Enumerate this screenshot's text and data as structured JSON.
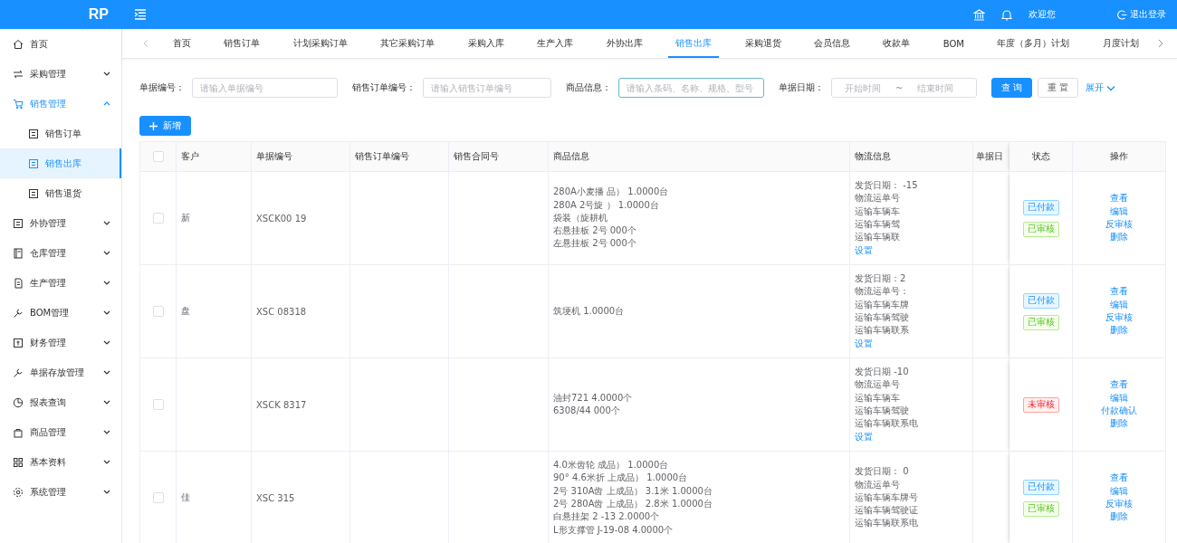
{
  "header": {
    "logo": "RP",
    "welcome": "欢迎您",
    "logout": "退出登录"
  },
  "sidebar": {
    "items": [
      {
        "label": "首页",
        "selected": false
      },
      {
        "label": "采购管理",
        "expanded": false,
        "selected": false
      },
      {
        "label": "销售管理",
        "expanded": true,
        "selected": true,
        "children": [
          {
            "label": "销售订单",
            "selected": false
          },
          {
            "label": "销售出库",
            "selected": true
          },
          {
            "label": "销售退货",
            "selected": false
          }
        ]
      },
      {
        "label": "外协管理",
        "expanded": false,
        "selected": false
      },
      {
        "label": "仓库管理",
        "expanded": false,
        "selected": false
      },
      {
        "label": "生产管理",
        "expanded": false,
        "selected": false
      },
      {
        "label": "BOM管理",
        "expanded": false,
        "selected": false
      },
      {
        "label": "财务管理",
        "expanded": false,
        "selected": false
      },
      {
        "label": "单据存放管理",
        "expanded": false,
        "selected": false
      },
      {
        "label": "报表查询",
        "expanded": false,
        "selected": false
      },
      {
        "label": "商品管理",
        "expanded": false,
        "selected": false
      },
      {
        "label": "基本资料",
        "expanded": false,
        "selected": false
      },
      {
        "label": "系统管理",
        "expanded": false,
        "selected": false
      }
    ]
  },
  "tabs": [
    {
      "label": "首页",
      "selected": false
    },
    {
      "label": "销售订单",
      "selected": false
    },
    {
      "label": "计划采购订单",
      "selected": false
    },
    {
      "label": "其它采购订单",
      "selected": false
    },
    {
      "label": "采购入库",
      "selected": false
    },
    {
      "label": "生产入库",
      "selected": false
    },
    {
      "label": "外协出库",
      "selected": false
    },
    {
      "label": "销售出库",
      "selected": true
    },
    {
      "label": "采购退货",
      "selected": false
    },
    {
      "label": "会员信息",
      "selected": false
    },
    {
      "label": "收款单",
      "selected": false
    },
    {
      "label": "BOM",
      "selected": false
    },
    {
      "label": "年度（多月）计划",
      "selected": false
    },
    {
      "label": "月度计划",
      "selected": false
    }
  ],
  "filters": {
    "fields": [
      {
        "label": "单据编号：",
        "placeholder": "请输入单据编号",
        "focused": false
      },
      {
        "label": "销售订单编号：",
        "placeholder": "请输入销售订单编号",
        "focused": false
      },
      {
        "label": "商品信息：",
        "placeholder": "请输入条码、名称、规格、型号",
        "focused": true
      }
    ],
    "date": {
      "label": "单据日期：",
      "start_placeholder": "开始时间",
      "separator": "~",
      "end_placeholder": "结束时间"
    },
    "buttons": [
      {
        "label": "查 询",
        "kind": "primary"
      },
      {
        "label": "重 置",
        "kind": "default"
      }
    ],
    "expand": "展开"
  },
  "add_button": "新增",
  "table": {
    "header_checked": false,
    "columns": [
      "客户",
      "单据编号",
      "销售订单编号",
      "销售合同号",
      "商品信息",
      "物流信息",
      "单据日",
      "状态",
      "操作"
    ],
    "rows": [
      {
        "checked": false,
        "customer": "新",
        "number": "XSCK00  19",
        "goods": [
          "280A小麦播   品）  1.0000台",
          "280A 2号旋   ）  1.0000台",
          "袋装（旋耕机",
          "右悬挂板 2号   000个",
          "左悬挂板 2号   000个"
        ],
        "logistics": [
          "发货日期：   -15",
          "物流运单号",
          "运输车辆车",
          "运输车辆驾",
          "运输车辆联"
        ],
        "logistics_link": "设置",
        "tags": [
          {
            "label": "已付款",
            "kind": "paid"
          },
          {
            "label": "已审核",
            "kind": "approved"
          }
        ],
        "actions": [
          "查看",
          "编辑",
          "反审核",
          "删除"
        ]
      },
      {
        "checked": false,
        "customer": "盘",
        "number": "XSC   08318",
        "goods": [
          "筑埂机     1.0000台"
        ],
        "logistics": [
          "发货日期：2",
          "物流运单号：",
          "运输车辆车牌",
          "运输车辆驾驶",
          "运输车辆联系"
        ],
        "logistics_link": "设置",
        "tags": [
          {
            "label": "已付款",
            "kind": "paid"
          },
          {
            "label": "已审核",
            "kind": "approved"
          }
        ],
        "actions": [
          "查看",
          "编辑",
          "反审核",
          "删除"
        ]
      },
      {
        "checked": false,
        "number": "XSCK   8317",
        "goods": [
          "油封721     4.0000个",
          "6308/44   000个"
        ],
        "logistics": [
          "发货日期   -10",
          "物流运单号",
          "运输车辆车",
          "运输车辆驾驶",
          "运输车辆联系电"
        ],
        "logistics_link": "设置",
        "tags": [
          {
            "label": "未审核",
            "kind": "unapproved"
          }
        ],
        "actions": [
          "查看",
          "编辑",
          "付款确认",
          "删除"
        ]
      },
      {
        "checked": false,
        "customer": "佳",
        "number": "XSC   315",
        "goods": [
          "4.0米齿轮   成品）  1.0000台",
          "90° 4.6米折   上成品）  1.0000台",
          "2号 310A齿   上成品）  3.1米 1.0000台",
          "2号 280A齿   上成品）  2.8米 1.0000台",
          "白悬挂架 2   -13 2.0000个",
          "L形支撑管   J-19-08 4.0000个"
        ],
        "logistics": [
          "发货日期：   0",
          "物流运单号",
          "运输车辆车牌号",
          "运输车辆驾驶证",
          "运输车辆联系电"
        ],
        "tags": [
          {
            "label": "已付款",
            "kind": "paid"
          },
          {
            "label": "已审核",
            "kind": "approved"
          }
        ],
        "actions": [
          "查看",
          "编辑",
          "反审核",
          "删除"
        ]
      }
    ]
  }
}
